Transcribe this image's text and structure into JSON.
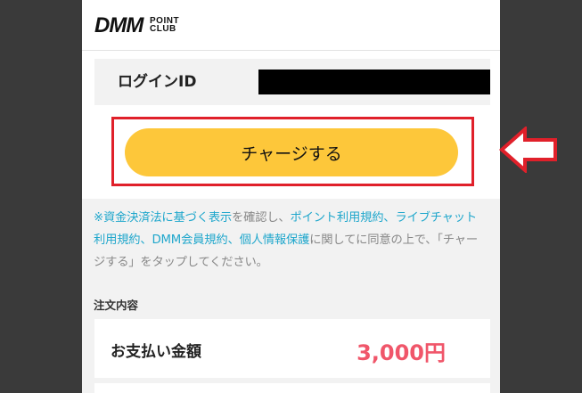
{
  "header": {
    "logo_main": "DMM",
    "logo_sub_1": "POINT",
    "logo_sub_2": "CLUB"
  },
  "login": {
    "label": "ログインID",
    "value": ""
  },
  "charge_button": {
    "label": "チャージする"
  },
  "notice": {
    "mark": "※",
    "link_1": "資金決済法に基づく表示",
    "text_1": "を確認し、",
    "link_2": "ポイント利用規約",
    "sep_1": "、",
    "link_3": "ライブチャット利用規約",
    "sep_2": "、",
    "link_4": "DMM会員規約",
    "sep_3": "、",
    "link_5": "個人情報保護",
    "text_2": "に関してに同意の上で、「チャージする」をタップしてください。"
  },
  "order": {
    "section_title": "注文内容",
    "label": "お支払い金額",
    "amount": "3,000円"
  },
  "colors": {
    "accent_yellow": "#fdc73a",
    "highlight_red": "#e0202a",
    "link_blue": "#20a7cc",
    "price_pink": "#f0566a"
  },
  "icons": {
    "pointer_arrow": "left-arrow-icon"
  }
}
